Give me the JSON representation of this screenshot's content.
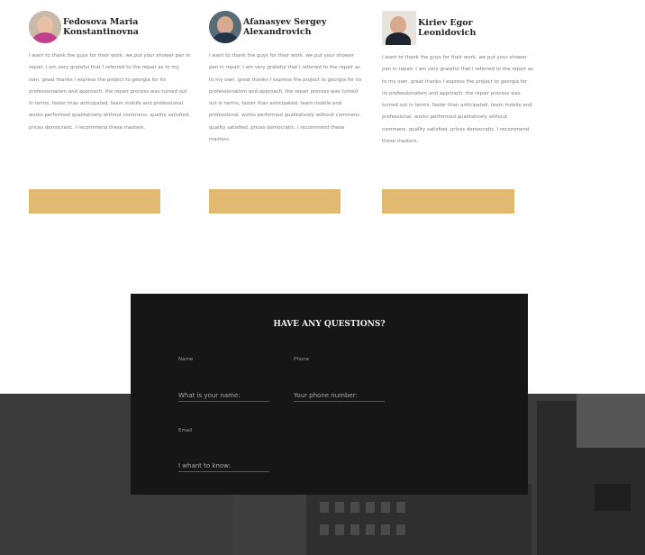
{
  "reviews": [
    {
      "name": "Fedosova Maria Konstantinovna",
      "text": "I want to thank the guys for their work. we put your shower pan in repair. I am very grateful that I referred to the repair as to my own. great thanks I express the project to georgia for its professionalism and approach. the repair process was turned out in terms, faster than anticipated. team mobile and professional. works performed qualitatively without commens. quality satisfied. prices democratic. I recommend these masters."
    },
    {
      "name": "Afanasyev Sergey Alexandrovich",
      "text": "I want to thank the guys for their work. we put your shower pan in repair. I am very grateful that I referred to the repair as to my own. great thanks I express the project to georgia for its professionalism and approach. the repair process was turned out in terms, faster than anticipated. team mobile and professional. works performed qualitatively without commens. quality satisfied. prices democratic. I recommend these masters."
    },
    {
      "name": "Kiriev Egor Leonidovich",
      "text": "I want to thank the guys for their work. we put your shower pan in repair. I am very grateful that I referred to the repair as to my own. great thanks I express the project to georgia for its professionalism and approach. the repair process was turned out in terms, faster than anticipated. team mobile and professional. works performed qualitatively without commens. quality satisfied. prices democratic. I recommend these masters."
    }
  ],
  "form": {
    "title": "HAVE ANY QUESTIONS?",
    "name_label": "Name",
    "name_placeholder": "What is your name:",
    "phone_label": "Phone",
    "phone_placeholder": "Your phone number:",
    "email_label": "Email",
    "email_placeholder": "I whant to know:"
  },
  "colors": {
    "accent": "#e2b970",
    "form_bg": "#161616"
  }
}
